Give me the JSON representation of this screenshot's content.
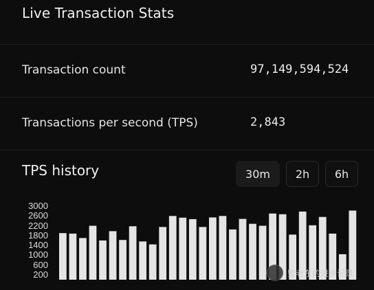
{
  "header": {
    "title": "Live Transaction Stats"
  },
  "stats": [
    {
      "label": "Transaction count",
      "value": "97,149,594,524"
    },
    {
      "label": "Transactions per second (TPS)",
      "value": "2,843"
    }
  ],
  "history": {
    "title": "TPS history",
    "ranges": [
      "30m",
      "2h",
      "6h"
    ],
    "active_range": "30m"
  },
  "watermark": {
    "text": "鳖老东的进步记录"
  },
  "chart_data": {
    "type": "bar",
    "title": "",
    "xlabel": "",
    "ylabel": "",
    "ylim": [
      0,
      3000
    ],
    "yticks": [
      200,
      600,
      1000,
      1400,
      1800,
      2200,
      2600,
      3000
    ],
    "color": "#e4e4e4",
    "values": [
      1900,
      1880,
      1700,
      2200,
      1600,
      1980,
      1620,
      2180,
      1560,
      1440,
      2150,
      2600,
      2530,
      2470,
      2150,
      2540,
      2600,
      2050,
      2480,
      2280,
      2200,
      2700,
      2670,
      1840,
      2780,
      2220,
      2560,
      1880,
      1040,
      2820
    ]
  }
}
